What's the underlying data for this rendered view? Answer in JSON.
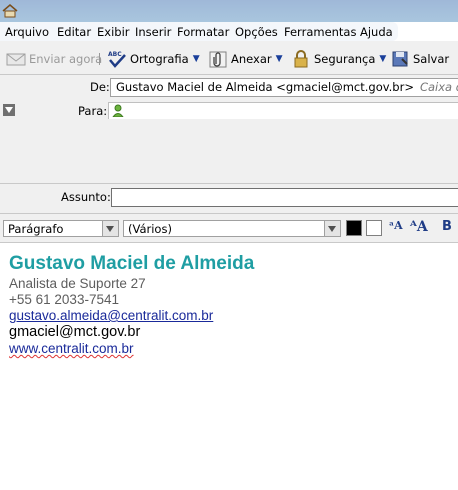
{
  "menu": [
    "Arquivo",
    "Editar",
    "Exibir",
    "Inserir",
    "Formatar",
    "Opções",
    "Ferramentas",
    "Ajuda"
  ],
  "toolbar": {
    "send": "Enviar agora",
    "spelling": "Ortografia",
    "attach": "Anexar",
    "security": "Segurança",
    "save": "Salvar"
  },
  "header": {
    "from_label": "De:",
    "from_value": "Gustavo Maciel de Almeida <gmaciel@mct.gov.br>",
    "from_account": "Caixa de Co",
    "to_label": "Para:",
    "to_value": "",
    "subject_label": "Assunto:",
    "subject_value": ""
  },
  "format": {
    "paragraph": "Parágrafo",
    "font": "(Vários)",
    "text_color": "#000000",
    "bg_color": "#ffffff"
  },
  "signature": {
    "name": "Gustavo Maciel de Almeida",
    "title": "Analista de Suporte 27",
    "phone": "+55 61 2033-7541",
    "email_link": "gustavo.almeida@centralit.com.br",
    "email": "gmaciel@mct.gov.br",
    "website": "www.centralit.com.br",
    "name_color": "#1f9ea3"
  }
}
